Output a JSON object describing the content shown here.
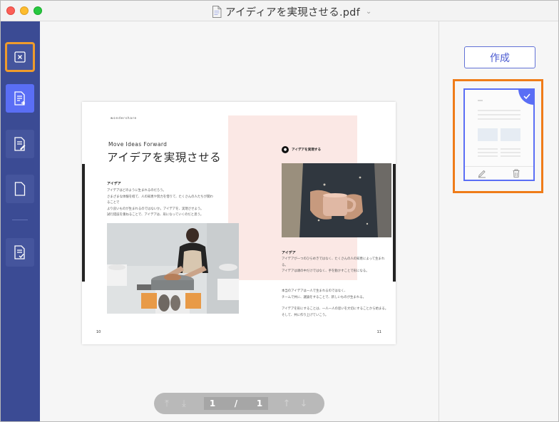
{
  "window": {
    "title": "アイディアを実現させる.pdf"
  },
  "sidebar": {
    "tools": [
      {
        "name": "close",
        "icon": "close-box-icon"
      },
      {
        "name": "create",
        "icon": "document-add-icon"
      },
      {
        "name": "edit",
        "icon": "document-edit-icon"
      },
      {
        "name": "blank",
        "icon": "blank-page-icon"
      },
      {
        "name": "form",
        "icon": "form-check-icon"
      }
    ]
  },
  "document": {
    "brand": "wondershare",
    "subtitle": "Move Ideas Forward",
    "headline": "アイデアを実現させる",
    "left_section_title": "アイデア",
    "left_body": "アイデアはどのように生まれるのだろう。\nさまざまな体験を経て、人の知恵や努力を借りて、たくさんの人たちが関わることで\nより良いものが生まれるのではないか。アイデアを、実現させよう。\n試行錯誤を重ねることで、アイデアは、形になっていくのだと思う。",
    "right_badge_label": "アイデアを実現する",
    "right_section_title": "アイデア",
    "right_body_1": "アイデアが一つのひらめきではなく、たくさんの人の知恵によって生まれる。\nアイデアは頭の中だけではなく、手を動かすことで形になる。",
    "right_body_2": "本当のアイデアは一人で生まれるのではなく、\nチームで共に、議論をすることで、新しいものが生まれる。",
    "right_body_3": "アイデアを形にすることは、一人一人の思いを大切にすることから始まる。\nそして、共に作り上げていこう。",
    "page_left": "10",
    "page_right": "11"
  },
  "pager": {
    "current": "1",
    "separator": "/",
    "total": "1"
  },
  "right_panel": {
    "create_label": "作成"
  },
  "colors": {
    "sidebar_bg": "#3b4b94",
    "accent": "#5a6ef5",
    "highlight": "#ef7c19"
  }
}
